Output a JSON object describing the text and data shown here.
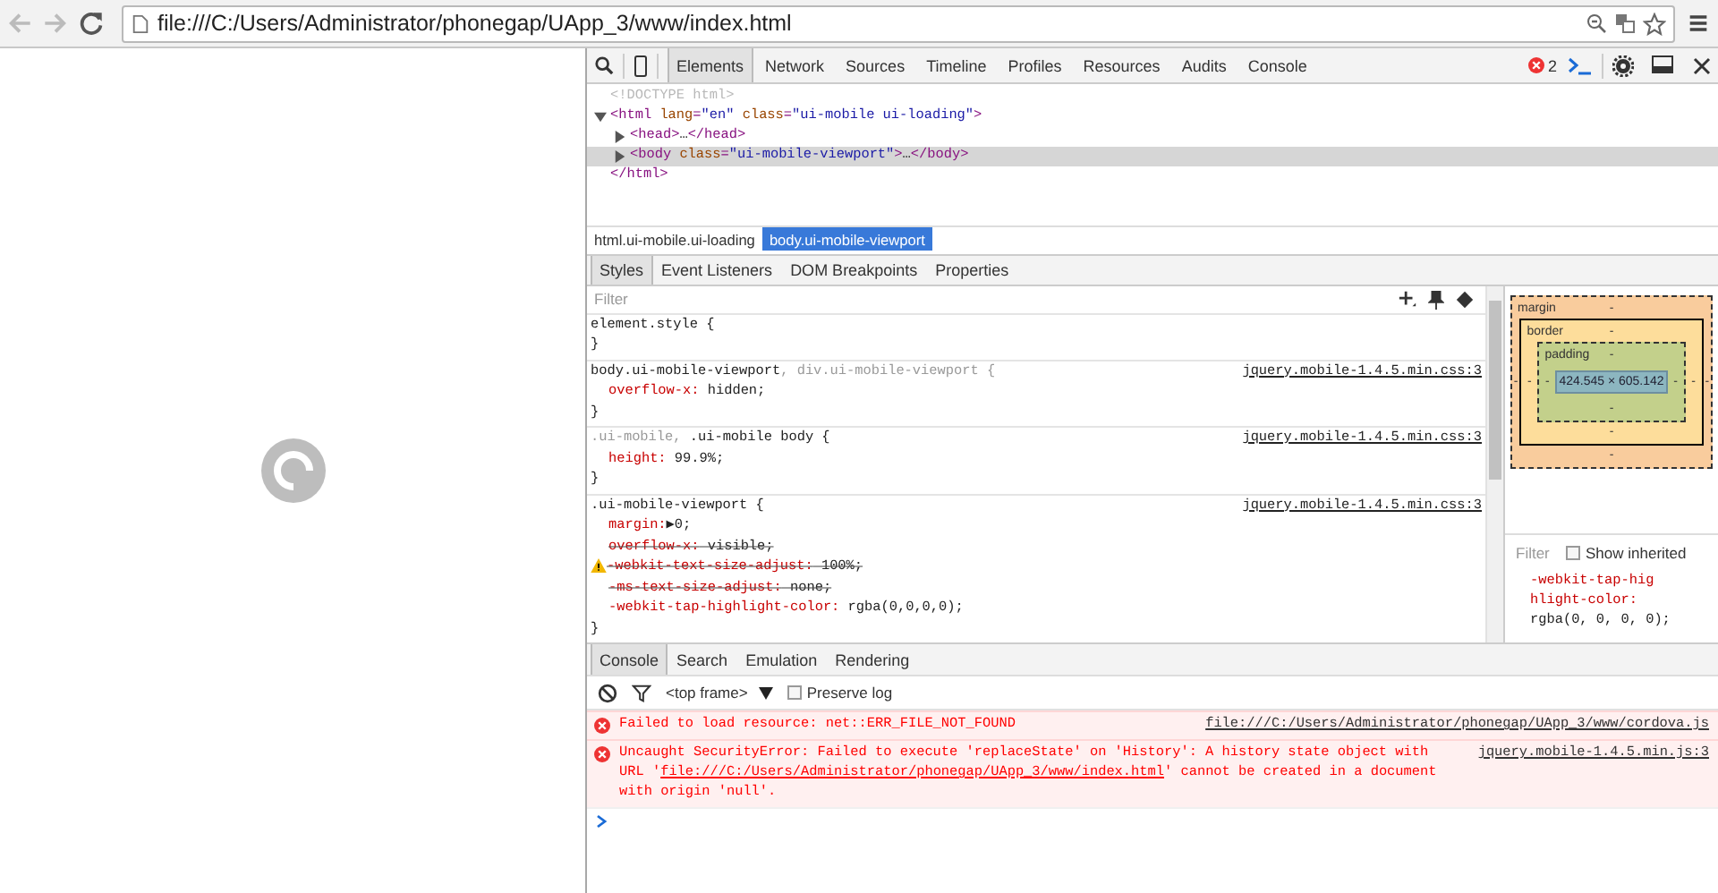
{
  "address_bar": {
    "url": "file:///C:/Users/Administrator/phonegap/UApp_3/www/index.html"
  },
  "devtools": {
    "tabs": [
      {
        "label": "Elements",
        "selected": true
      },
      {
        "label": "Network",
        "selected": false
      },
      {
        "label": "Sources",
        "selected": false
      },
      {
        "label": "Timeline",
        "selected": false
      },
      {
        "label": "Profiles",
        "selected": false
      },
      {
        "label": "Resources",
        "selected": false
      },
      {
        "label": "Audits",
        "selected": false
      },
      {
        "label": "Console",
        "selected": false
      }
    ],
    "error_count": "2",
    "dom_tree": [
      {
        "kind": "doctype",
        "tokens": [
          {
            "kind": "doctype",
            "text": "<!DOCTYPE html>"
          }
        ]
      },
      {
        "kind": "element",
        "expanded": true,
        "selected": false,
        "tokens": [
          {
            "kind": "tag",
            "text": "<html"
          },
          {
            "kind": "attr",
            "text": " lang"
          },
          {
            "kind": "tag",
            "text": "="
          },
          {
            "kind": "value",
            "text": "\"en\""
          },
          {
            "kind": "attr",
            "text": " class"
          },
          {
            "kind": "tag",
            "text": "="
          },
          {
            "kind": "value",
            "text": "\"ui-mobile ui-loading\""
          },
          {
            "kind": "tag",
            "text": ">"
          }
        ],
        "closing": "</html>",
        "children": [
          {
            "kind": "element",
            "expanded": false,
            "selected": false,
            "tokens": [
              {
                "kind": "tag",
                "text": "<head>"
              },
              {
                "kind": "plain",
                "text": "…"
              },
              {
                "kind": "tag",
                "text": "</head>"
              }
            ]
          },
          {
            "kind": "element",
            "expanded": false,
            "selected": true,
            "tokens": [
              {
                "kind": "tag",
                "text": "<body"
              },
              {
                "kind": "attr",
                "text": " class"
              },
              {
                "kind": "tag",
                "text": "="
              },
              {
                "kind": "value",
                "text": "\"ui-mobile-viewport\""
              },
              {
                "kind": "tag",
                "text": ">"
              },
              {
                "kind": "plain",
                "text": "…"
              },
              {
                "kind": "tag",
                "text": "</body>"
              }
            ]
          }
        ]
      }
    ],
    "breadcrumbs": [
      {
        "label": "html.ui-mobile.ui-loading",
        "selected": false
      },
      {
        "label": "body.ui-mobile-viewport",
        "selected": true
      }
    ],
    "panel_tabs": [
      {
        "label": "Styles",
        "selected": true
      },
      {
        "label": "Event Listeners",
        "selected": false
      },
      {
        "label": "DOM Breakpoints",
        "selected": false
      },
      {
        "label": "Properties",
        "selected": false
      }
    ],
    "styles": {
      "filter_placeholder": "Filter",
      "rules": [
        {
          "selector": [
            {
              "text": "element.style",
              "matched": true
            }
          ],
          "open": " {",
          "close": "}"
        },
        {
          "selector": [
            {
              "text": "body.ui-mobile-viewport",
              "matched": true
            },
            {
              "text": ", div.ui-mobile-viewport",
              "matched": false
            }
          ],
          "open": " {",
          "close": "}",
          "source": "jquery.mobile-1.4.5.min.css:3",
          "properties": [
            {
              "name": "overflow-x:",
              "value": " hidden;",
              "overridden": false,
              "warning": false
            }
          ]
        },
        {
          "selector": [
            {
              "text": ".ui-mobile,",
              "matched": false
            },
            {
              "text": " .ui-mobile body",
              "matched": true
            }
          ],
          "open": " {",
          "close": "}",
          "source": "jquery.mobile-1.4.5.min.css:3",
          "properties": [
            {
              "name": "height:",
              "value": " 99.9%;",
              "overridden": false,
              "warning": false
            }
          ]
        },
        {
          "selector": [
            {
              "text": ".ui-mobile-viewport",
              "matched": true
            }
          ],
          "open": " {",
          "close": "}",
          "source": "jquery.mobile-1.4.5.min.css:3",
          "properties": [
            {
              "name": "margin:",
              "value": "▶0;",
              "overridden": false,
              "warning": false
            },
            {
              "name": "overflow-x:",
              "value": " visible;",
              "overridden": true,
              "warning": false
            },
            {
              "name": "-webkit-text-size-adjust:",
              "value": " 100%;",
              "overridden": true,
              "warning": true
            },
            {
              "name": "-ms-text-size-adjust:",
              "value": " none;",
              "overridden": true,
              "warning": false
            },
            {
              "name": "-webkit-tap-highlight-color:",
              "value": " rgba(0,0,0,0);",
              "overridden": false,
              "warning": false
            }
          ]
        }
      ]
    },
    "box_model": {
      "label": "margin",
      "top": "-",
      "left": "-",
      "inner": {
        "label": "border",
        "top": "-",
        "left": "-",
        "inner": {
          "label": "padding",
          "top": "-",
          "left": "-",
          "content": "424.545 × 605.142",
          "right": "-",
          "bottom": "-"
        },
        "right": "-",
        "bottom": "-"
      },
      "right": "-",
      "bottom": "-"
    },
    "computed": {
      "filter_placeholder": "Filter",
      "show_inherited": {
        "label": "Show inherited",
        "checked": false
      },
      "properties": [
        {
          "name": "-webkit-tap-highlight-color:",
          "value": "rgba(0, 0, 0, 0);"
        }
      ]
    },
    "drawer_tabs": [
      {
        "label": "Console",
        "selected": true
      },
      {
        "label": "Search",
        "selected": false
      },
      {
        "label": "Emulation",
        "selected": false
      },
      {
        "label": "Rendering",
        "selected": false
      }
    ],
    "console": {
      "frame": "<top frame>",
      "preserve_log": {
        "label": "Preserve log",
        "checked": false
      },
      "messages": [
        {
          "parts": [
            {
              "text": "Failed to load resource: net::ERR_FILE_NOT_FOUND",
              "link": false
            }
          ],
          "source": "file:///C:/Users/Administrator/phonegap/UApp_3/www/cordova.js"
        },
        {
          "parts": [
            {
              "text": "Uncaught SecurityError: Failed to execute 'replaceState' on 'History': A history state object with URL '",
              "link": false
            },
            {
              "text": "file:///C:/Users/Administrator/phonegap/UApp_3/www/index.html",
              "link": true
            },
            {
              "text": "' cannot be created in a document with origin 'null'.",
              "link": false
            }
          ],
          "source": "jquery.mobile-1.4.5.min.js:3"
        }
      ]
    }
  }
}
